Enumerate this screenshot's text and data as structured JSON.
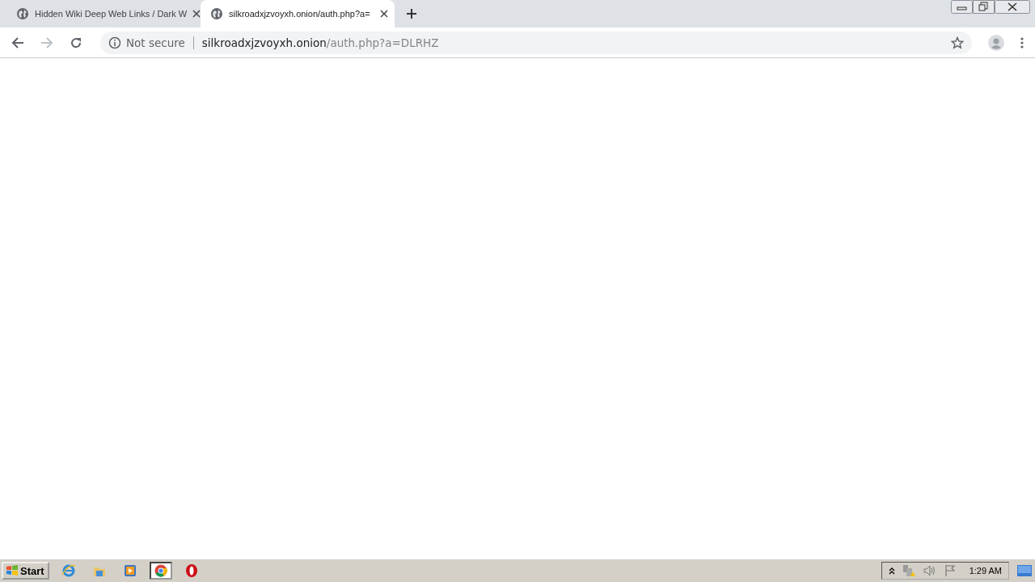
{
  "tabs": [
    {
      "title": "Hidden Wiki Deep Web Links / Dark W",
      "selected": false
    },
    {
      "title": "silkroadxjzvoyxh.onion/auth.php?a=",
      "selected": true
    }
  ],
  "address_bar": {
    "security": "Not secure",
    "host": "silkroadxjzvoyxh.onion",
    "path": "/auth.php?a=DLRHZ"
  },
  "taskbar": {
    "start": "Start",
    "apps": [
      {
        "kind": "ie",
        "selected": false
      },
      {
        "kind": "folder",
        "selected": false
      },
      {
        "kind": "media",
        "selected": false
      },
      {
        "kind": "chrome",
        "selected": true
      },
      {
        "kind": "opera",
        "selected": false
      }
    ],
    "clock": "1:29 AM"
  }
}
